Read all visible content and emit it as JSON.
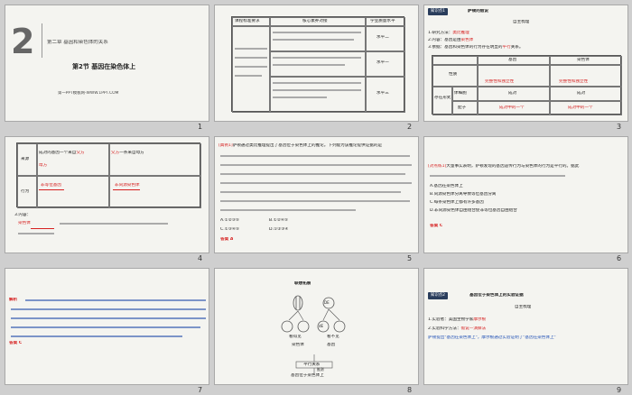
{
  "thumbnails": [
    {
      "num": "1"
    },
    {
      "num": "2"
    },
    {
      "num": "3"
    },
    {
      "num": "4"
    },
    {
      "num": "5"
    },
    {
      "num": "6"
    },
    {
      "num": "7"
    },
    {
      "num": "8"
    },
    {
      "num": "9"
    }
  ],
  "s1": {
    "big_num": "2",
    "chapter": "第二章    基因和染色体的关系",
    "section": "第2节  基因在染色体上",
    "footer": "第一PPT模板网-WWW.1PPT.COM"
  },
  "s2": {
    "headers": [
      "课程标准要求",
      "核心素养对接",
      "学业质量水平"
    ],
    "rows": [
      {
        "level": "水平二"
      },
      {
        "level": "水平一"
      },
      {
        "level": "水平三"
      }
    ]
  },
  "s3": {
    "badge": "知识点1",
    "heading": "萨顿的假说",
    "subhead": "自主梳理",
    "l1_pre": "1.研究方法：",
    "l1_ans": "类比推理",
    "l2_pre": "2.内容：基因是由",
    "l2_ans": "染色体",
    "l3_pre": "3.依据：基因和染色体的行为存在明显的",
    "l3_ans": "平行",
    "l3_post": "关系。",
    "col_gene": "基因",
    "col_chrom": "染色体",
    "row_nature": "性质",
    "ans_indep": "完整性和独立性",
    "row_exist": "存在形式",
    "row_somatic": "体细胞",
    "row_gamete": "配子",
    "paired": "成对",
    "single": "成对中的一个"
  },
  "s4": {
    "row_source": "来源",
    "src_mid": "成对的基因一个来自",
    "ans_father": "父方",
    "src_tail": "一条来自母方",
    "ans_mother": "母方",
    "row_behavior": "行为",
    "ans_nonallelic": "非等位基因",
    "ans_nonhomologous": "非同源染色体",
    "q3": "3.内容：",
    "ans_chrom": "染色体"
  },
  "s5": {
    "q_label": "[典例1]",
    "q_body": "萨顿通过类比推理提出了基因位于染色体上的推论。下列能为该推论提供证据的是",
    "options": [
      "A.①②③⑤",
      "B.①②④⑤",
      "C.①③④⑤",
      "D.①②③④"
    ],
    "answer_label": "答案",
    "answer": "A"
  },
  "s6": {
    "q_label": "[对点练1]",
    "q_body": "大量事实表明，萨顿发现的基因遗传行为与染色体的行为是平行的。据此",
    "opt_a": "A.基因在染色体上",
    "opt_b": "B.同源染色体分离导致等位基因分离",
    "opt_c": "C.每条染色体上都有许多基因",
    "opt_d": "D.非同源染色体自由组合使非等位基因自由组合",
    "answer_label": "答案",
    "answer": "C"
  },
  "s7": {
    "analysis": "解析",
    "answer_label": "答案",
    "answer": "C"
  },
  "s8": {
    "title": "联想拓展",
    "n1": "DE",
    "n2": "dE",
    "l1": "看得见",
    "l2": "看不见",
    "l3": "染色体",
    "l4": "基因",
    "l5": "平行关系",
    "l6": "推测",
    "l7": "基因位于染色体上"
  },
  "s9": {
    "badge": "知识点2",
    "heading": "基因位于染色体上的实验证据",
    "subhead": "自主梳理",
    "l1_pre": "1.实验者：美国生物学家",
    "l1_ans": "摩尔根",
    "l2_pre": "2.实验科学方法：",
    "l2_ans": "假说—演绎法",
    "l3": "萨顿提出\"基因在染色体上\"，摩尔根通过实验证明了\"基因在染色体上\""
  }
}
